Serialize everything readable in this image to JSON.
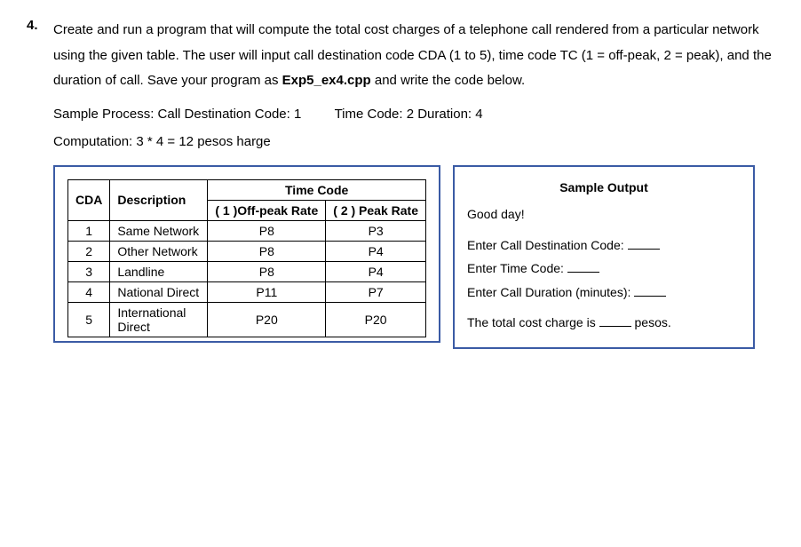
{
  "question": {
    "number": "4.",
    "text_part1": "Create and run a program that will compute the total cost charges of a telephone call rendered from a particular network using the given table. The user will input call destination code CDA (1 to 5), time code TC (1 = off-peak, 2 = peak), and the duration of call. Save your program as ",
    "filename": "Exp5_ex4.cpp",
    "text_part2": " and write the code below.",
    "sample_process_label": "Sample Process: Call Destination Code: 1",
    "time_code_label": "Time Code: 2  Duration: 4",
    "computation": "Computation: 3 * 4 = 12 pesos harge"
  },
  "rate_table": {
    "headers": {
      "cda": "CDA",
      "description": "Description",
      "time_code": "Time Code",
      "offpeak": "( 1 )Off-peak Rate",
      "peak": "( 2 ) Peak Rate"
    },
    "rows": [
      {
        "cda": "1",
        "desc": "Same Network",
        "offpeak": "P8",
        "peak": "P3"
      },
      {
        "cda": "2",
        "desc": "Other Network",
        "offpeak": "P8",
        "peak": "P4"
      },
      {
        "cda": "3",
        "desc": "Landline",
        "offpeak": "P8",
        "peak": "P4"
      },
      {
        "cda": "4",
        "desc": "National Direct",
        "offpeak": "P11",
        "peak": "P7"
      },
      {
        "cda": "5",
        "desc": "International Direct",
        "offpeak": "P20",
        "peak": "P20"
      }
    ]
  },
  "sample_output": {
    "title": "Sample Output",
    "greeting": "Good day!",
    "line1_label": "Enter Call Destination Code:",
    "line2_label": "Enter Time Code:",
    "line3_label": "Enter Call Duration (minutes):",
    "result_prefix": "The total cost charge is",
    "result_suffix": "pesos."
  }
}
